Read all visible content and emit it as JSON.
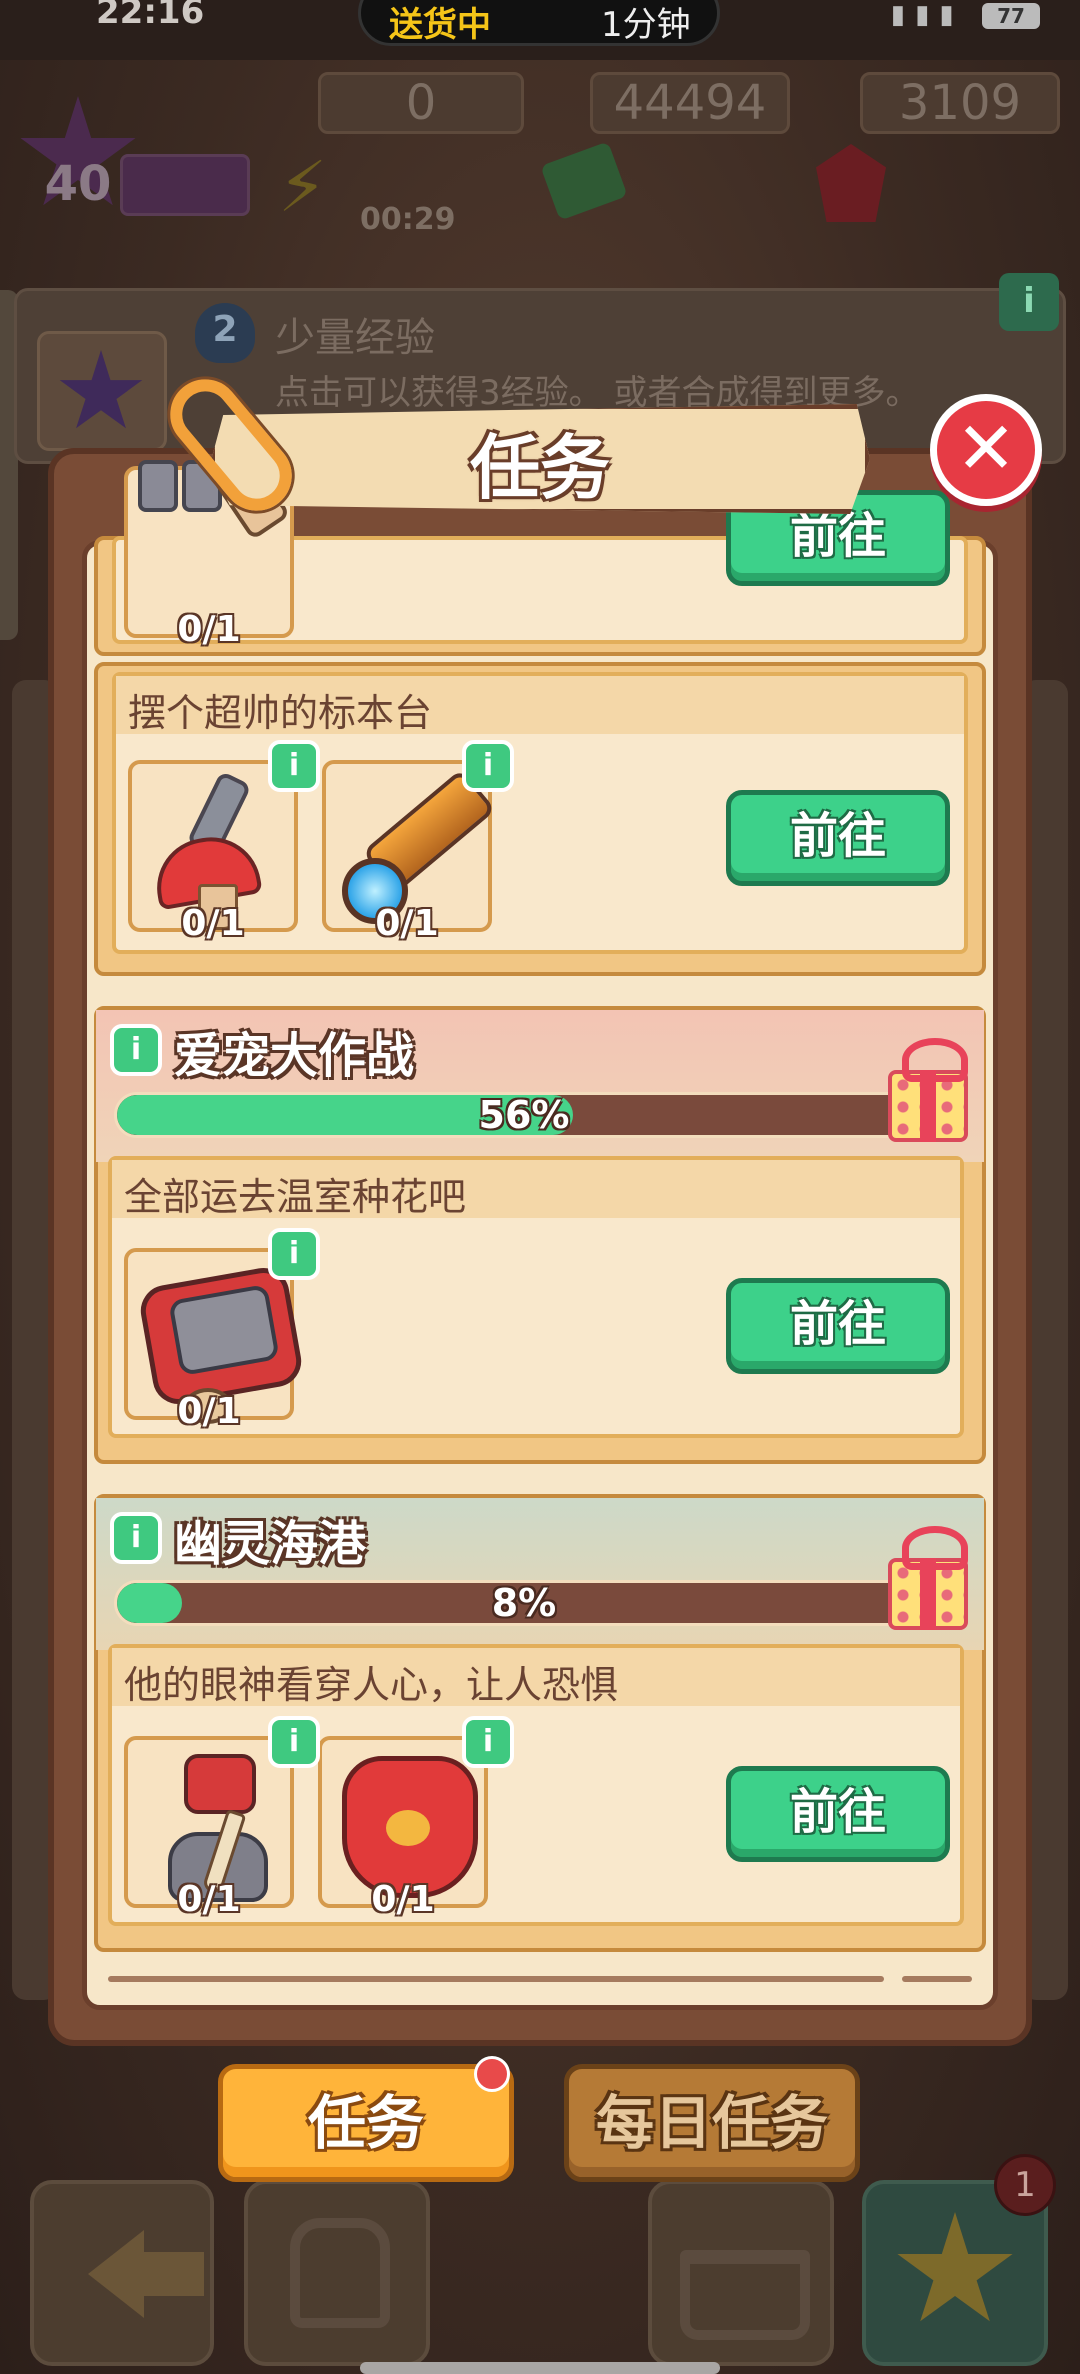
{
  "status_bar": {
    "time": "22:16",
    "pill_left": "送货中",
    "pill_right": "1分钟",
    "battery": "77"
  },
  "resources": {
    "level": "40",
    "energy": "0",
    "energy_timer": "00:29",
    "cash": "44494",
    "gems": "3109"
  },
  "info_strip": {
    "badge": "2",
    "title": "少量经验",
    "desc": "点击可以获得3经验。 或者合成得到更多。",
    "info_label": "i"
  },
  "modal": {
    "title": "任务",
    "close_label": "✕"
  },
  "tasks": [
    {
      "title": "",
      "slots": [
        {
          "count": "0/1"
        }
      ],
      "go_label": "前往"
    },
    {
      "title": "摆个超帅的标本台",
      "slots": [
        {
          "count": "0/1"
        },
        {
          "count": "0/1"
        }
      ],
      "go_label": "前往"
    },
    {
      "chapter": "爱宠大作战",
      "progress": 56,
      "progress_label": "56%",
      "title": "全部运去温室种花吧",
      "slots": [
        {
          "count": "0/1"
        }
      ],
      "go_label": "前往"
    },
    {
      "chapter": "幽灵海港",
      "progress": 8,
      "progress_label": "8%",
      "title": "他的眼神看穿人心，让人恐惧",
      "slots": [
        {
          "count": "0/1"
        },
        {
          "count": "0/1"
        }
      ],
      "go_label": "前往"
    }
  ],
  "tabs": {
    "tasks": "任务",
    "daily": "每日任务"
  },
  "nav": {
    "badge_count": "1"
  },
  "colors": {
    "go_button": "#3dd18a",
    "progress_fill": "#46d48a",
    "active_tab": "#ffb43a",
    "close": "#e63b45"
  }
}
